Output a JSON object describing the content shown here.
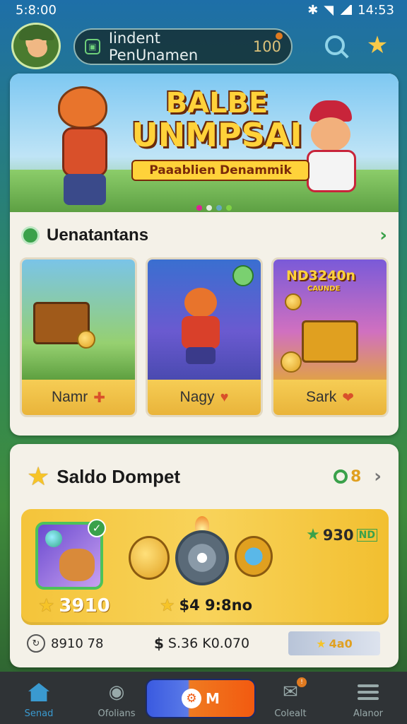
{
  "status": {
    "left": "5:8:00",
    "right": "14:53"
  },
  "header": {
    "search_text": "Iindent PenUnamen",
    "count": "100"
  },
  "banner": {
    "title_line1": "BALBE",
    "title_line2": "UNMPSAI",
    "subtitle": "Paaablien Denammik"
  },
  "section1": {
    "title": "Uenatantans",
    "tiles": [
      {
        "label": "Namr"
      },
      {
        "label": "Nagy"
      },
      {
        "label": "Sark",
        "art_title": "ND3240n",
        "art_sub": "CAUNDE"
      }
    ]
  },
  "wallet": {
    "title": "Saldo Dompet",
    "badge": "8",
    "pet_value": "3910",
    "mid_value": "$4 9:8no",
    "right_value": "930",
    "right_unit": "ND",
    "foot_a": "8910 78",
    "foot_b": "S.36 K0.070",
    "foot_c": "4a0"
  },
  "nav": {
    "items": [
      {
        "label": "Senad"
      },
      {
        "label": "Ofolians"
      },
      {
        "label": "M"
      },
      {
        "label": "Colealt"
      },
      {
        "label": "Alanor"
      }
    ]
  },
  "colors": {
    "accent": "#3aa14a",
    "gold": "#f6c428",
    "nav_active": "#3a9ad0"
  }
}
